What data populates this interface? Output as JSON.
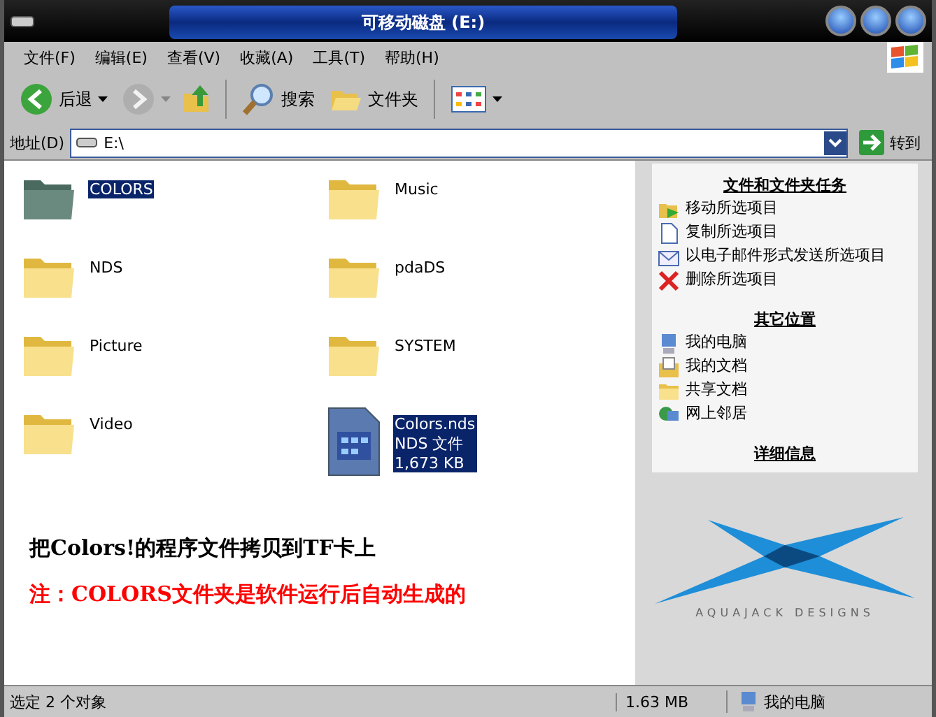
{
  "window": {
    "title": "可移动磁盘 (E:)"
  },
  "menu": [
    "文件(F)",
    "编辑(E)",
    "查看(V)",
    "收藏(A)",
    "工具(T)",
    "帮助(H)"
  ],
  "toolbar": {
    "back": "后退",
    "search": "搜索",
    "folders": "文件夹"
  },
  "address": {
    "label": "地址(D)",
    "value": "E:\\",
    "go": "转到"
  },
  "files": [
    {
      "name": "COLORS",
      "kind": "folder",
      "selected": true
    },
    {
      "name": "Music",
      "kind": "folder",
      "selected": false
    },
    {
      "name": "NDS",
      "kind": "folder",
      "selected": false
    },
    {
      "name": "pdaDS",
      "kind": "folder",
      "selected": false
    },
    {
      "name": "Picture",
      "kind": "folder",
      "selected": false
    },
    {
      "name": "SYSTEM",
      "kind": "folder",
      "selected": false
    },
    {
      "name": "Video",
      "kind": "folder",
      "selected": false
    },
    {
      "name": "Colors.nds",
      "kind": "file",
      "selected": true,
      "type": "NDS 文件",
      "size": "1,673 KB"
    }
  ],
  "notes": [
    {
      "text": "把Colors!的程序文件拷贝到TF卡上",
      "color": "#000000"
    },
    {
      "text": "注：COLORS文件夹是软件运行后自动生成的",
      "color": "#ff0000"
    }
  ],
  "tasks": {
    "sections": [
      {
        "title": "文件和文件夹任务",
        "items": [
          {
            "label": "移动所选项目",
            "kind": "move"
          },
          {
            "label": "复制所选项目",
            "kind": "copy"
          },
          {
            "label": "以电子邮件形式发送所选项目",
            "kind": "mail"
          },
          {
            "label": "删除所选项目",
            "kind": "delete"
          }
        ]
      },
      {
        "title": "其它位置",
        "items": [
          {
            "label": "我的电脑",
            "kind": "computer"
          },
          {
            "label": "我的文档",
            "kind": "docs"
          },
          {
            "label": "共享文档",
            "kind": "folder"
          },
          {
            "label": "网上邻居",
            "kind": "network"
          }
        ]
      },
      {
        "title": "详细信息"
      }
    ]
  },
  "logo_caption": "AQUAJACK DESIGNS",
  "status_bar": {
    "selection": "选定 2 个对象",
    "size": "1.63 MB",
    "location": "我的电脑"
  }
}
